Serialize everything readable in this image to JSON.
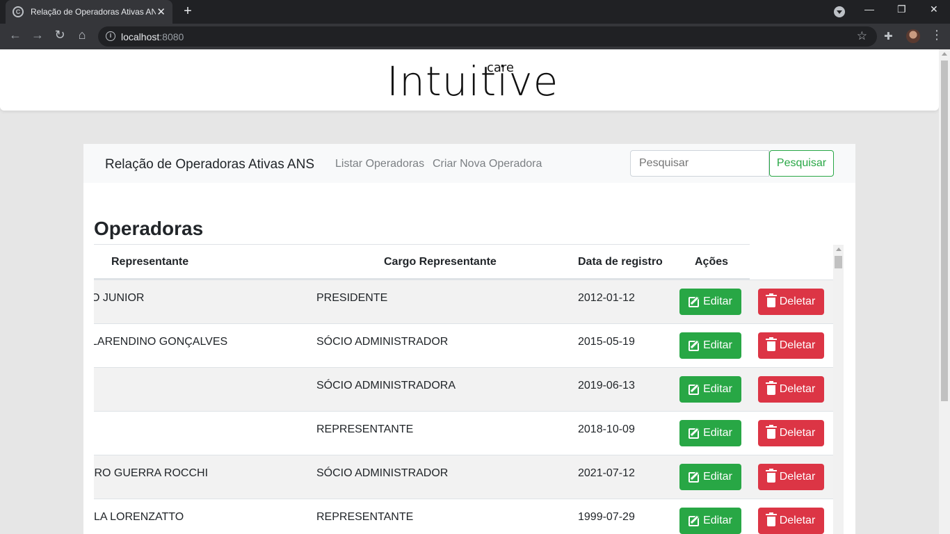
{
  "browser": {
    "tab_title": "Relação de Operadoras Ativas ANS",
    "favicon_letter": "C",
    "url_host": "localhost",
    "url_port": ":8080"
  },
  "logo": {
    "word": "Intuitive",
    "sub": "care"
  },
  "navbar": {
    "brand": "Relação de Operadoras Ativas ANS",
    "links": [
      "Listar Operadoras",
      "Criar Nova Operadora"
    ],
    "search_placeholder": "Pesquisar",
    "search_button": "Pesquisar"
  },
  "content": {
    "title": "Operadoras",
    "columns": {
      "representante": "Representante",
      "cargo": "Cargo Representante",
      "data": "Data de registro",
      "acoes": "Ações"
    },
    "edit_label": "Editar",
    "delete_label": "Deletar",
    "rows": [
      {
        "representante": "O JUNIOR",
        "cargo": "PRESIDENTE",
        "data": "2012-01-12"
      },
      {
        "representante": "LARENDINO GONÇALVES",
        "cargo": "SÓCIO ADMINISTRADOR",
        "data": "2015-05-19"
      },
      {
        "representante": "",
        "cargo": "SÓCIO ADMINISTRADORA",
        "data": "2019-06-13"
      },
      {
        "representante": "",
        "cargo": "REPRESENTANTE",
        "data": "2018-10-09"
      },
      {
        "representante": "IRO GUERRA ROCCHI",
        "cargo": "SÓCIO ADMINISTRADOR",
        "data": "2021-07-12"
      },
      {
        "representante": "LA LORENZATTO",
        "cargo": "REPRESENTANTE",
        "data": "1999-07-29"
      }
    ]
  }
}
